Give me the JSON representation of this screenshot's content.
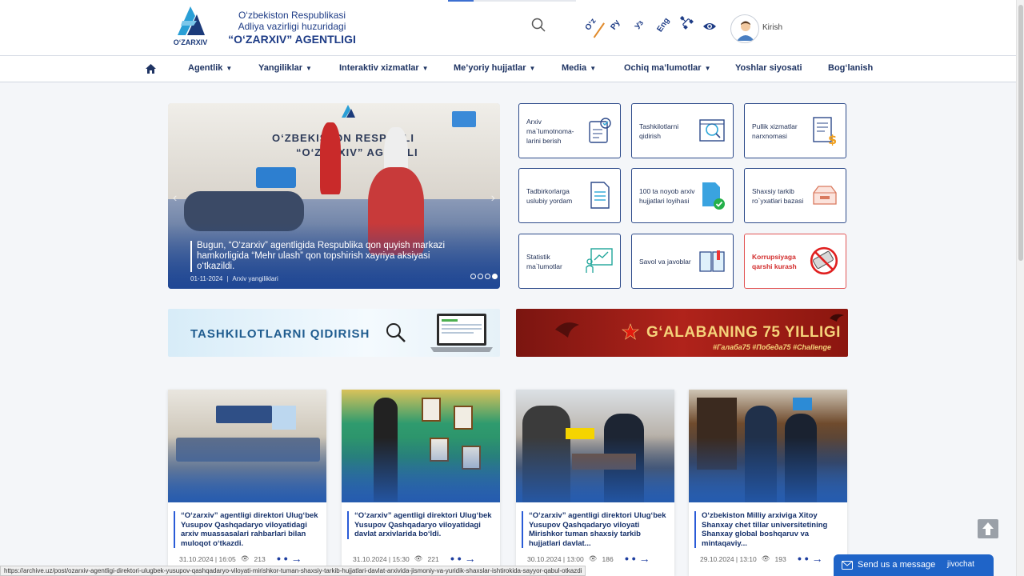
{
  "header": {
    "logo_text": "O‘ZARXIV",
    "brand_line1": "O‘zbekiston Respublikasi",
    "brand_line2": "Adliya vazirligi huzuridagi",
    "brand_line3": "“O‘ZARXIV” AGENTLIGI",
    "languages": [
      "O‘z",
      "Ру",
      "Уз",
      "Eng"
    ],
    "login_label": "Kirish"
  },
  "nav": {
    "items": [
      "Agentlik",
      "Yangiliklar",
      "Interaktiv xizmatlar",
      "Me’yoriy hujjatlar",
      "Media",
      "Ochiq ma’lumotlar",
      "Yoshlar siyosati",
      "Bog‘lanish"
    ]
  },
  "slider": {
    "sign1": "O‘ZBEKISTON RESPUBLI",
    "sign2": "“O‘ZARXIV” AGENTLI",
    "title": "Bugun, “O‘zarxiv” agentligida Respublika qon quyish markazi hamkorligida “Mehr ulash” qon topshirish xayriya aksiyasi o‘tkazildi.",
    "date": "01-11-2024",
    "category": "Arxiv yangiliklari"
  },
  "services": [
    {
      "label": "Arxiv ma`lumotnoma-larini berish",
      "icon": "certificate-icon"
    },
    {
      "label": "Tashkilotlarni qidirish",
      "icon": "organization-search-icon"
    },
    {
      "label": "Pullik xizmatlar narxnomasi",
      "icon": "price-list-icon"
    },
    {
      "label": "Tadbirkorlarga uslubiy yordam",
      "icon": "document-icon"
    },
    {
      "label": "100 ta noyob arxiv hujjatlari loyihasi",
      "icon": "verified-document-icon"
    },
    {
      "label": "Shaxsiy tarkib ro`yxatlari bazasi",
      "icon": "archive-box-icon"
    },
    {
      "label": "Statistik ma`lumotlar",
      "icon": "statistics-icon"
    },
    {
      "label": "Savol va javoblar",
      "icon": "book-icon"
    },
    {
      "label": "Korrupsiyaga qarshi kurash",
      "icon": "anti-corruption-icon"
    }
  ],
  "banners": {
    "left": "TASHKILOTLARNI QIDIRISH",
    "right": "G‘ALABANING 75 YILLIGI",
    "right_tags": "#Галаба75 #Победа75 #Challenge"
  },
  "news": [
    {
      "title": "“O‘zarxiv” agentligi direktori Ulug‘bek Yusupov Qashqadaryo viloyatidagi arxiv muassasalari rahbarlari bilan muloqot o‘tkazdi.",
      "date": "31.10.2024 | 16:05",
      "views": "213"
    },
    {
      "title": "“O‘zarxiv” agentligi direktori Ulug‘bek Yusupov Qashqadaryo viloyatidagi davlat arxivlarida bo‘ldi.",
      "date": "31.10.2024 | 15:30",
      "views": "221"
    },
    {
      "title": "“O‘zarxiv” agentligi direktori Ulug‘bek Yusupov Qashqadaryo viloyati Mirishkor tuman shaxsiy tarkib hujjatlari davlat...",
      "date": "30.10.2024 | 13:00",
      "views": "186"
    },
    {
      "title": "O‘zbekiston Milliy arxiviga Xitoy Shanxay chet tillar universitetining Shanxay global boshqaruv va mintaqaviy...",
      "date": "29.10.2024 | 13:10",
      "views": "193"
    }
  ],
  "status_url": "https://archive.uz/post/ozarxiv-agentligi-direktori-ulugbek-yusupov-qashqadaryo-viloyati-mirishkor-tuman-shaxsiy-tarkib-hujjatlari-davlat-arxivida-jismoniy-va-yuridik-shaxslar-ishtirokida-sayyor-qabul-otkazdi",
  "chat": {
    "label": "Send us a message",
    "brand": "jivochat"
  },
  "colors": {
    "primary": "#1e3c86",
    "accent": "#2a5bd7",
    "danger": "#d22c2c"
  }
}
